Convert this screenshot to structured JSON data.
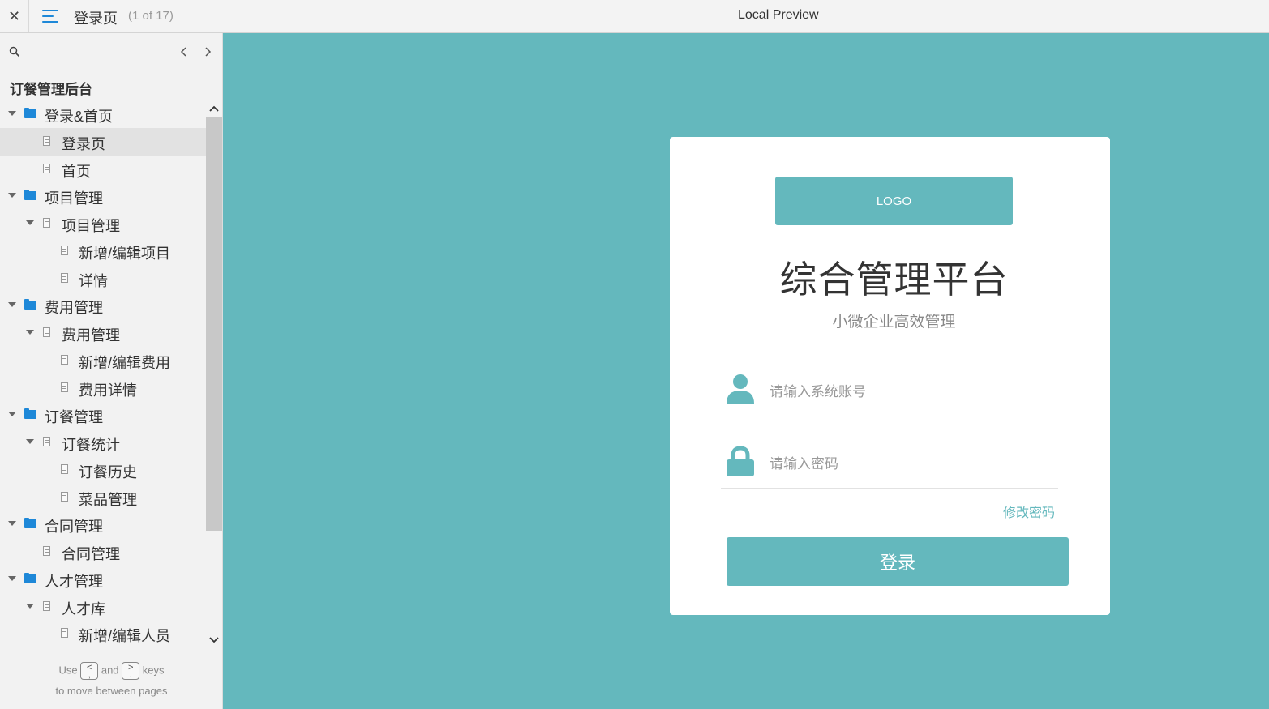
{
  "topbar": {
    "close_glyph": "✕",
    "page_title": "登录页",
    "page_count": "(1 of 17)",
    "preview_title": "Local Preview"
  },
  "sidebar": {
    "project_title": "订餐管理后台",
    "prev_glyph": "‹",
    "next_glyph": "›",
    "tree": [
      {
        "label": "登录&首页",
        "type": "folder",
        "level": 0,
        "expanded": true
      },
      {
        "label": "登录页",
        "type": "page",
        "level": 1,
        "selected": true
      },
      {
        "label": "首页",
        "type": "page",
        "level": 1
      },
      {
        "label": "项目管理",
        "type": "folder",
        "level": 0,
        "expanded": true
      },
      {
        "label": "项目管理",
        "type": "page",
        "level": 1,
        "expanded": true
      },
      {
        "label": "新增/编辑项目",
        "type": "page",
        "level": 2
      },
      {
        "label": "详情",
        "type": "page",
        "level": 2
      },
      {
        "label": "费用管理",
        "type": "folder",
        "level": 0,
        "expanded": true
      },
      {
        "label": "费用管理",
        "type": "page",
        "level": 1,
        "expanded": true
      },
      {
        "label": "新增/编辑费用",
        "type": "page",
        "level": 2
      },
      {
        "label": "费用详情",
        "type": "page",
        "level": 2
      },
      {
        "label": "订餐管理",
        "type": "folder",
        "level": 0,
        "expanded": true
      },
      {
        "label": "订餐统计",
        "type": "page",
        "level": 1,
        "expanded": true
      },
      {
        "label": "订餐历史",
        "type": "page",
        "level": 2
      },
      {
        "label": "菜品管理",
        "type": "page",
        "level": 2
      },
      {
        "label": "合同管理",
        "type": "folder",
        "level": 0,
        "expanded": true
      },
      {
        "label": "合同管理",
        "type": "page",
        "level": 1
      },
      {
        "label": "人才管理",
        "type": "folder",
        "level": 0,
        "expanded": true
      },
      {
        "label": "人才库",
        "type": "page",
        "level": 1,
        "expanded": true
      },
      {
        "label": "新增/编辑人员",
        "type": "page",
        "level": 2
      }
    ],
    "help": {
      "use": "Use",
      "and": "and",
      "keys": "keys",
      "line2": "to move between pages",
      "key_prev": "<\n,",
      "key_next": ">\n."
    }
  },
  "login_card": {
    "logo": "LOGO",
    "title": "综合管理平台",
    "subtitle": "小微企业高效管理",
    "account_placeholder": "请输入系统账号",
    "password_placeholder": "请输入密码",
    "change_password": "修改密码",
    "login_button": "登录"
  },
  "colors": {
    "accent": "#64b8bd",
    "folder": "#1e88d8",
    "sidebar_bg": "#f2f2f2"
  }
}
